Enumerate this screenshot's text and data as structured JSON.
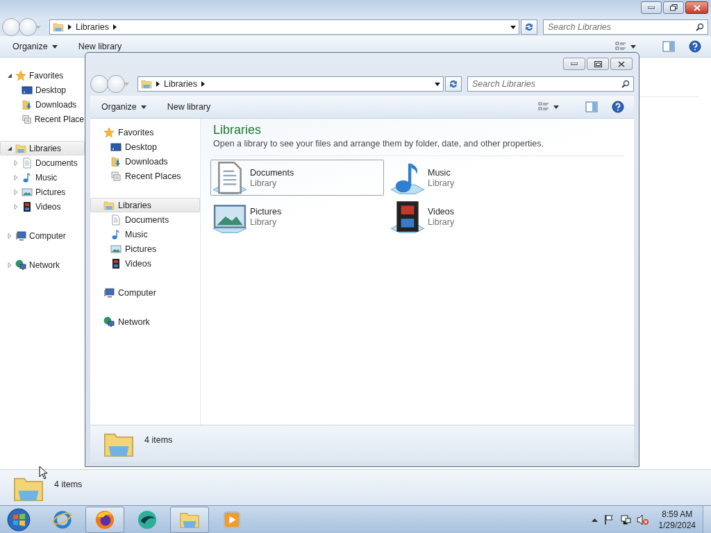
{
  "back_window": {
    "address": {
      "crumbs": [
        "Libraries"
      ]
    },
    "search": {
      "placeholder": "Search Libraries"
    },
    "toolbar": [
      "Organize",
      "New library"
    ],
    "nav": [
      {
        "label": "Favorites",
        "kind": "star",
        "expanded": true,
        "selected": false,
        "children": [
          {
            "label": "Desktop",
            "kind": "desktop",
            "selected": false
          },
          {
            "label": "Downloads",
            "kind": "downloads",
            "selected": false
          },
          {
            "label": "Recent Place",
            "kind": "recent",
            "selected": false
          }
        ]
      },
      {
        "label": "Libraries",
        "kind": "library",
        "expanded": true,
        "selected": true,
        "children": [
          {
            "label": "Documents",
            "kind": "documents",
            "expanded": false,
            "selected": false
          },
          {
            "label": "Music",
            "kind": "music",
            "expanded": false,
            "selected": false
          },
          {
            "label": "Pictures",
            "kind": "pictures",
            "expanded": false,
            "selected": false
          },
          {
            "label": "Videos",
            "kind": "videos",
            "expanded": false,
            "selected": false
          }
        ]
      },
      {
        "label": "Computer",
        "kind": "computer",
        "expanded": false,
        "selected": false
      },
      {
        "label": "Network",
        "kind": "network",
        "expanded": false,
        "selected": false
      }
    ],
    "status": "4 items"
  },
  "front_window": {
    "address": {
      "crumbs": [
        "Libraries"
      ]
    },
    "search": {
      "placeholder": "Search Libraries"
    },
    "toolbar": [
      "Organize",
      "New library"
    ],
    "nav": [
      {
        "label": "Favorites",
        "kind": "star",
        "selected": false,
        "children": [
          {
            "label": "Desktop",
            "kind": "desktop",
            "selected": false
          },
          {
            "label": "Downloads",
            "kind": "downloads",
            "selected": false
          },
          {
            "label": "Recent Places",
            "kind": "recent",
            "selected": false
          }
        ]
      },
      {
        "label": "Libraries",
        "kind": "library",
        "selected": true,
        "children": [
          {
            "label": "Documents",
            "kind": "documents",
            "selected": false
          },
          {
            "label": "Music",
            "kind": "music",
            "selected": false
          },
          {
            "label": "Pictures",
            "kind": "pictures",
            "selected": false
          },
          {
            "label": "Videos",
            "kind": "videos",
            "selected": false
          }
        ]
      },
      {
        "label": "Computer",
        "kind": "computer",
        "selected": false
      },
      {
        "label": "Network",
        "kind": "network",
        "selected": false
      }
    ],
    "content": {
      "title": "Libraries",
      "subtitle": "Open a library to see your files and arrange them by folder, date, and other properties.",
      "libraries": [
        {
          "name": "Documents",
          "type": "Library",
          "kind": "documents",
          "selected": true
        },
        {
          "name": "Music",
          "type": "Library",
          "kind": "music",
          "selected": false
        },
        {
          "name": "Pictures",
          "type": "Library",
          "kind": "pictures",
          "selected": false
        },
        {
          "name": "Videos",
          "type": "Library",
          "kind": "videos",
          "selected": false
        }
      ]
    },
    "status": "4 items"
  },
  "taskbar": {
    "apps": [
      {
        "kind": "ring",
        "open": false
      },
      {
        "kind": "globe",
        "open": true
      },
      {
        "kind": "sphere",
        "open": false
      },
      {
        "kind": "library",
        "open": true
      },
      {
        "kind": "player",
        "open": false
      }
    ],
    "clock": {
      "time": "8:59 AM",
      "date": "1/29/2024"
    }
  }
}
